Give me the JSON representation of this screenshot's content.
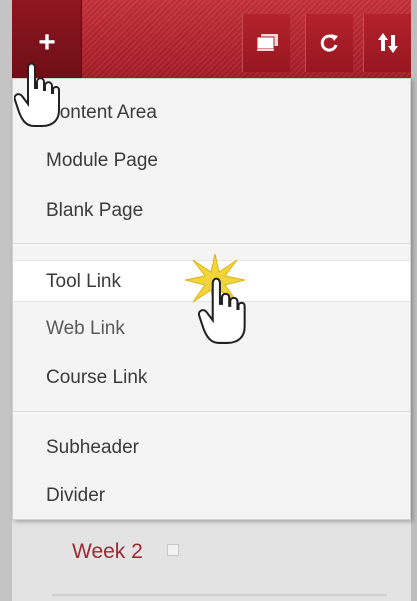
{
  "toolbar": {
    "add_icon": "plus-icon",
    "add_glyph": "+",
    "buttons": [
      {
        "name": "folder-view-icon"
      },
      {
        "name": "refresh-icon"
      },
      {
        "name": "reorder-icon"
      }
    ],
    "colors": {
      "bar": "#b3222d",
      "add_button": "#7d121b"
    }
  },
  "add_menu": {
    "groups": [
      [
        "Content Area",
        "Module Page",
        "Blank Page"
      ],
      [
        "Tool Link",
        "Web Link",
        "Course Link"
      ],
      [
        "Subheader",
        "Divider"
      ]
    ],
    "highlighted_item": "Tool Link"
  },
  "course_menu": {
    "items": [
      {
        "label": "Week 2"
      }
    ],
    "accent_color": "#9b2a33"
  },
  "cursors": [
    "hand-cursor-icon",
    "click-burst-icon"
  ]
}
